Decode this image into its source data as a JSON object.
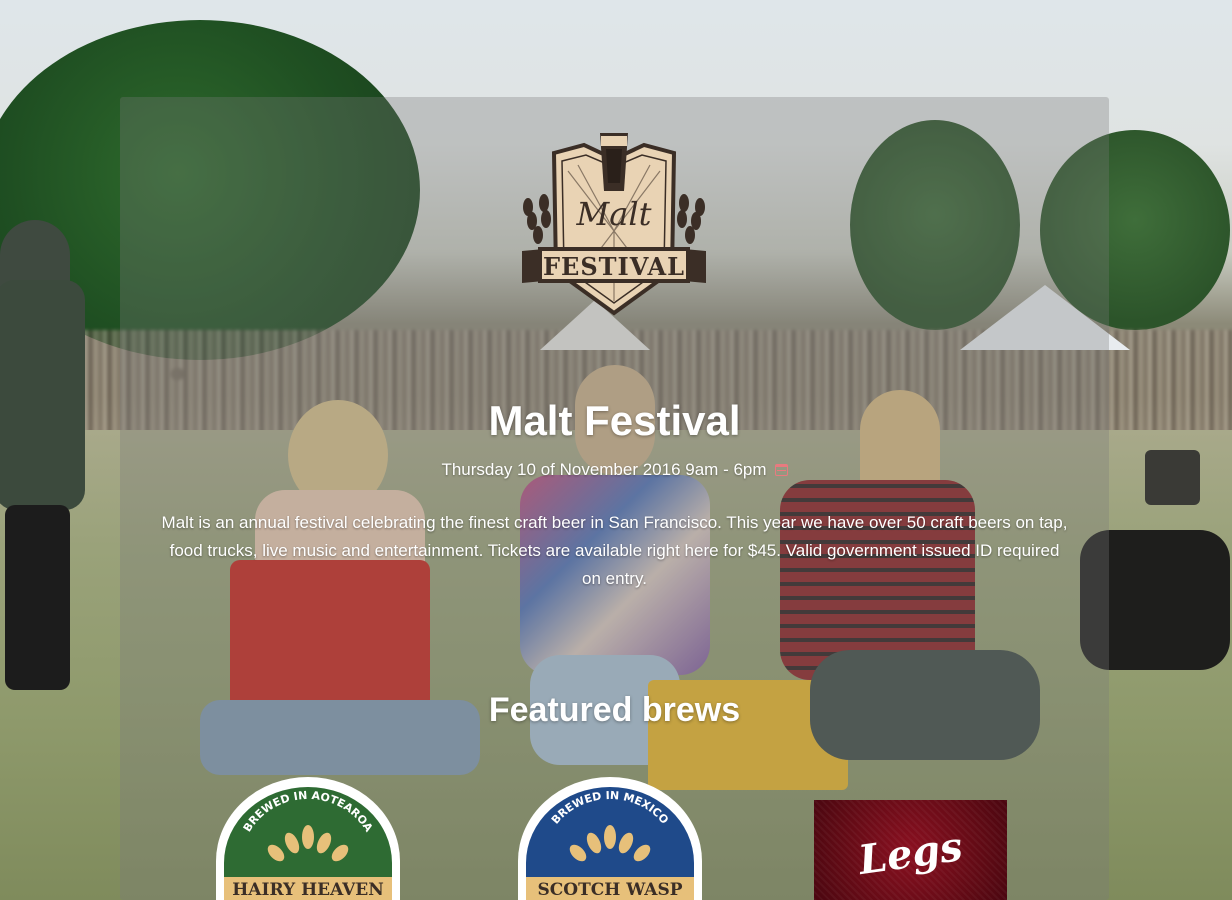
{
  "logo": {
    "word_top": "Malt",
    "word_bottom": "FESTIVAL"
  },
  "event": {
    "title": "Malt Festival",
    "date": "Thursday 10 of November 2016 9am - 6pm",
    "description": "Malt is an annual festival celebrating the finest craft beer in San Francisco. This year we have over 50 craft beers on tap, food trucks, live music and entertainment. Tickets are available right here for $45. Valid government issued ID required on entry."
  },
  "featured": {
    "heading": "Featured brews",
    "brews": [
      {
        "arc_text": "BREWED IN AOTEAROA",
        "name": "HAIRY HEAVEN",
        "color": "#2e6b33"
      },
      {
        "arc_text": "BREWED IN MEXICO",
        "name": "SCOTCH WASP",
        "color": "#1f4a8a"
      },
      {
        "name": "Legs",
        "color": "#6e0c18"
      }
    ]
  },
  "colors": {
    "calendar_icon": "#e97a7f",
    "logo_brown": "#3b2e26",
    "logo_cream": "#e9d3b4"
  }
}
